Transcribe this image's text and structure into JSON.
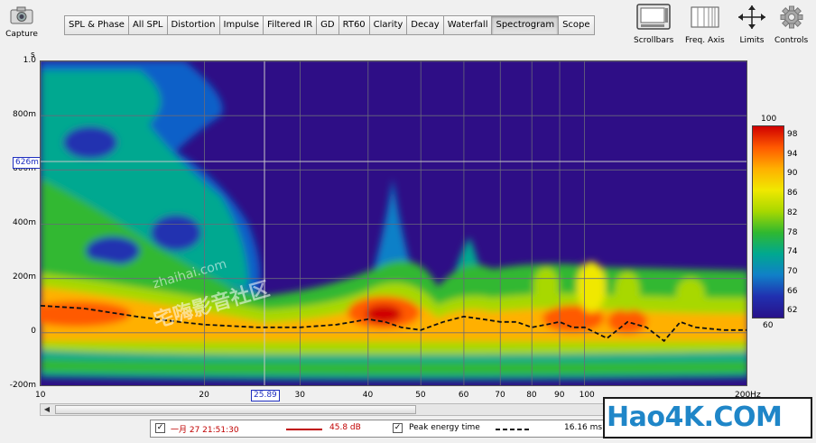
{
  "toolbar": {
    "capture_label": "Capture",
    "tabs": [
      "SPL & Phase",
      "All SPL",
      "Distortion",
      "Impulse",
      "Filtered IR",
      "GD",
      "RT60",
      "Clarity",
      "Decay",
      "Waterfall",
      "Spectrogram",
      "Scope"
    ],
    "active_tab": "Spectrogram",
    "tools": [
      "Scrollbars",
      "Freq. Axis",
      "Limits",
      "Controls"
    ]
  },
  "plot": {
    "y_unit": "s",
    "y_ticks": [
      "1.0",
      "800m",
      "600m",
      "400m",
      "200m",
      "0",
      "-200m"
    ],
    "x_ticks": [
      "10",
      "20",
      "30",
      "40",
      "50",
      "60",
      "70",
      "80",
      "90",
      "100",
      "200Hz"
    ],
    "cursor_y": "626m",
    "cursor_x": "25.89"
  },
  "colorbar": {
    "max": "100",
    "min": "60",
    "labels": [
      "98",
      "94",
      "90",
      "86",
      "82",
      "78",
      "74",
      "70",
      "66",
      "62"
    ],
    "colors": [
      "#d00000",
      "#ff5a00",
      "#ffb000",
      "#f0e800",
      "#a8d800",
      "#30b830",
      "#00a890",
      "#1080c8",
      "#2030b0",
      "#28128a"
    ]
  },
  "legend": {
    "series1_label": "一月 27 21:51:30",
    "series1_value": "45.8 dB",
    "series1_color": "#c00000",
    "series2_label": "Peak energy time",
    "series2_value": "16.16 ms"
  },
  "watermarks": {
    "corner": "Hao4K.COM",
    "site": "zhaihai.com",
    "site_cn": "宅嗨影音社区"
  },
  "chart_data": {
    "type": "heatmap",
    "x_scale": "log",
    "xlim": [
      10,
      200
    ],
    "ylim": [
      -0.2,
      1.0
    ],
    "ylabel": "s",
    "zlim": [
      60,
      100
    ],
    "peak_energy_time": {
      "x": [
        10,
        12,
        15,
        18,
        20,
        25,
        30,
        35,
        40,
        43,
        46,
        50,
        55,
        60,
        65,
        70,
        75,
        80,
        85,
        90,
        95,
        100,
        110,
        120,
        130,
        140,
        150,
        160,
        180,
        200
      ],
      "y": [
        0.1,
        0.09,
        0.06,
        0.04,
        0.03,
        0.02,
        0.02,
        0.03,
        0.05,
        0.04,
        0.02,
        0.01,
        0.04,
        0.06,
        0.05,
        0.04,
        0.04,
        0.02,
        0.03,
        0.04,
        0.02,
        0.02,
        -0.02,
        0.04,
        0.02,
        -0.03,
        0.04,
        0.02,
        0.01,
        0.01
      ]
    }
  }
}
